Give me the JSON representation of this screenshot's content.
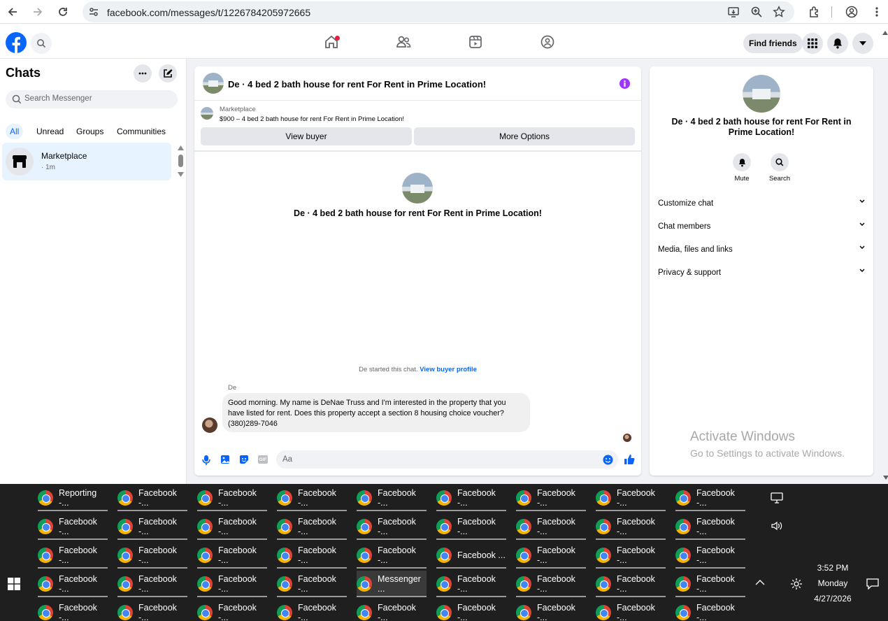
{
  "browser": {
    "url": "facebook.com/messages/t/1226784205972665"
  },
  "fb": {
    "find_friends": "Find friends"
  },
  "left": {
    "title": "Chats",
    "search_placeholder": "Search Messenger",
    "filters": [
      "All",
      "Unread",
      "Groups",
      "Communities"
    ],
    "chat_item": {
      "name": "Marketplace",
      "time": "· 1m"
    }
  },
  "chat": {
    "header_title": "De · 4 bed 2 bath house for rent For Rent in Prime Location!",
    "listing_source": "Marketplace",
    "listing_text": "$900 – 4 bed 2 bath house for rent For Rent in Prime Location!",
    "view_buyer": "View buyer",
    "more_options": "More Options",
    "center_title": "De · 4 bed 2 bath house for rent For Rent in Prime Location!",
    "started": "De started this chat.",
    "view_profile": "View buyer profile",
    "sender": "De",
    "message_line1": "Good morning. My name is DeNae Truss and I'm interested in the property that you",
    "message_line2": "have listed for rent. Does this property accept a section 8 housing choice voucher?",
    "message_line3": "(380)289-7046",
    "composer_placeholder": "Aa",
    "gif_label": "GIF"
  },
  "info": {
    "title": "De · 4 bed 2 bath house for rent For Rent in Prime Location!",
    "mute": "Mute",
    "search": "Search",
    "sections": [
      "Customize chat",
      "Chat members",
      "Media, files and links",
      "Privacy & support"
    ],
    "watermark_title": "Activate Windows",
    "watermark_sub": "Go to Settings to activate Windows."
  },
  "taskbar": {
    "rows": [
      [
        "Reporting -...",
        "Facebook -...",
        "Facebook -...",
        "Facebook -...",
        "Facebook -...",
        "Facebook -...",
        "Facebook -...",
        "Facebook -...",
        "Facebook -..."
      ],
      [
        "Facebook -...",
        "Facebook -...",
        "Facebook -...",
        "Facebook -...",
        "Facebook -...",
        "Facebook -...",
        "Facebook -...",
        "Facebook -...",
        "Facebook -..."
      ],
      [
        "Facebook -...",
        "Facebook -...",
        "Facebook -...",
        "Facebook -...",
        "Facebook -...",
        "Facebook ...",
        "Facebook -...",
        "Facebook -...",
        "Facebook -..."
      ],
      [
        "Facebook -...",
        "Facebook -...",
        "Facebook -...",
        "Facebook -...",
        "Messenger ...",
        "Facebook -...",
        "Facebook -...",
        "Facebook -...",
        "Facebook -..."
      ],
      [
        "Facebook -...",
        "Facebook -...",
        "Facebook -...",
        "Facebook -...",
        "Facebook -...",
        "Facebook -...",
        "Facebook -...",
        "Facebook -...",
        "Facebook -..."
      ]
    ],
    "clock_time": "3:52 PM",
    "clock_day": "Monday",
    "clock_date": "4/27/2026"
  },
  "colors": {
    "accent": "#0866ff",
    "purple": "#a033ff",
    "selected_chat_bg": "#e7f3ff",
    "taskbar_bg": "#1f1f1f"
  }
}
